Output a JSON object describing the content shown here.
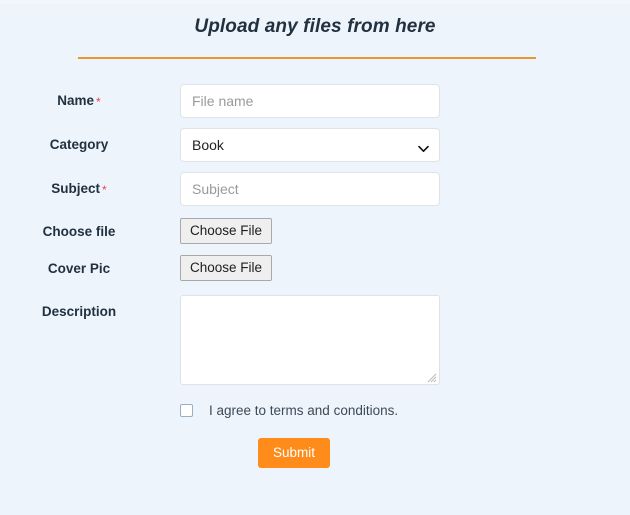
{
  "form": {
    "title": "Upload any files from here",
    "accent_color": "#e8962e",
    "submit_color": "#ff8c1a",
    "required_marker": "*",
    "fields": [
      {
        "label": "Name",
        "required": true,
        "type": "text",
        "value": "",
        "placeholder": "File name"
      },
      {
        "label": "Category",
        "required": false,
        "type": "select",
        "selected": "Book",
        "chevron_icon": "chevron-down-icon"
      },
      {
        "label": "Subject",
        "required": true,
        "type": "text",
        "value": "",
        "placeholder": "Subject"
      },
      {
        "label": "Choose file",
        "required": false,
        "type": "file",
        "button_label": "Choose File"
      },
      {
        "label": "Cover Pic",
        "required": false,
        "type": "file",
        "button_label": "Choose File"
      },
      {
        "label": "Description",
        "required": false,
        "type": "textarea",
        "value": "",
        "placeholder": ""
      }
    ],
    "agreement": {
      "checked": false,
      "text": "I agree to terms and conditions."
    },
    "submit_label": "Submit"
  }
}
